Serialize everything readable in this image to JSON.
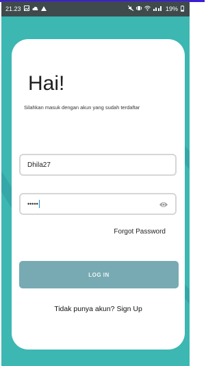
{
  "status_bar": {
    "time": "21.23",
    "right_text": "19%",
    "icons": [
      "gallery-icon",
      "cloud-icon",
      "warning-icon",
      "mute-icon",
      "vibrate-icon",
      "wifi-icon",
      "signal-icon",
      "battery-icon"
    ]
  },
  "login": {
    "title": "Hai!",
    "subtitle": "Silahkan masuk dengan akun yang sudah terdaftar",
    "username_value": "Dhila27",
    "password_value": "•••••",
    "forgot_label": "Forgot Password",
    "login_label": "LOG IN",
    "signup_prompt": "Tidak punya akun?",
    "signup_label": "Sign Up"
  },
  "colors": {
    "background": "#3cb7b2",
    "card": "#ffffff",
    "button": "#77aab3",
    "statusbar": "#3f4a4c"
  }
}
